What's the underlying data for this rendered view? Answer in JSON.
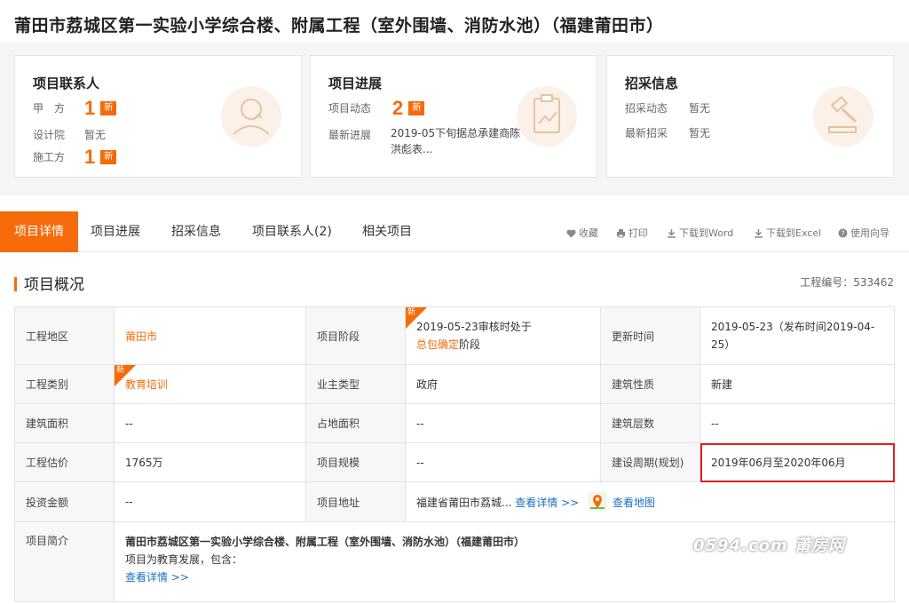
{
  "page": {
    "title": "莆田市荔城区第一实验小学综合楼、附属工程（室外围墙、消防水池）（福建莆田市）"
  },
  "cards": {
    "contacts": {
      "title": "项目联系人",
      "rows": [
        {
          "label": "甲　方",
          "value": "1",
          "badge": "新"
        },
        {
          "label": "设计院",
          "value": "暂无"
        },
        {
          "label": "施工方",
          "value": "1",
          "badge": "新"
        }
      ]
    },
    "progress": {
      "title": "项目进展",
      "dynamic_label": "项目动态",
      "dynamic_value": "2",
      "badge": "新",
      "latest_label": "最新进展",
      "latest_text": "2019-05下旬据总承建商陈洪彪表..."
    },
    "procurement": {
      "title": "招采信息",
      "rows": [
        {
          "label": "招采动态",
          "value": "暂无"
        },
        {
          "label": "最新招采",
          "value": "暂无"
        }
      ]
    }
  },
  "tabs": [
    "项目详情",
    "项目进展",
    "招采信息",
    "项目联系人(2)",
    "相关项目"
  ],
  "active_tab": 0,
  "tools": {
    "favorite": "收藏",
    "print": "打印",
    "word": "下载到Word",
    "excel": "下载到Excel",
    "guide": "使用向导"
  },
  "section": {
    "title": "项目概况",
    "eng_no": "工程编号：533462"
  },
  "table": {
    "region_k": "工程地区",
    "region_v": "莆田市",
    "stage_k": "项目阶段",
    "stage_v1": "2019-05-23审核时处于",
    "stage_link": "总包确定",
    "stage_v2": "阶段",
    "update_k": "更新时间",
    "update_v": "2019-05-23（发布时间2019-04-25）",
    "category_k": "工程类别",
    "category_v": "教育培训",
    "owner_k": "业主类型",
    "owner_v": "政府",
    "nature_k": "建筑性质",
    "nature_v": "新建",
    "area_k": "建筑面积",
    "area_v": "--",
    "land_k": "占地面积",
    "land_v": "--",
    "floors_k": "建筑层数",
    "floors_v": "--",
    "estimate_k": "工程估价",
    "estimate_v": "1765万",
    "scale_k": "项目规模",
    "scale_v": "--",
    "period_k": "建设周期(规划)",
    "period_v": "2019年06月至2020年06月",
    "invest_k": "投资金额",
    "invest_v": "--",
    "address_k": "项目地址",
    "address_v": "福建省莆田市荔城...",
    "address_more": "查看详情 >>",
    "map": "查看地图",
    "intro_k": "项目简介",
    "intro_title": "莆田市荔城区第一实验小学综合楼、附属工程（室外围墙、消防水池）（福建莆田市）",
    "intro_text": "项目为教育发展，包含：",
    "intro_more": "查看详情 >>"
  },
  "badge_new": "新",
  "watermark": "0594.com 莆房网"
}
